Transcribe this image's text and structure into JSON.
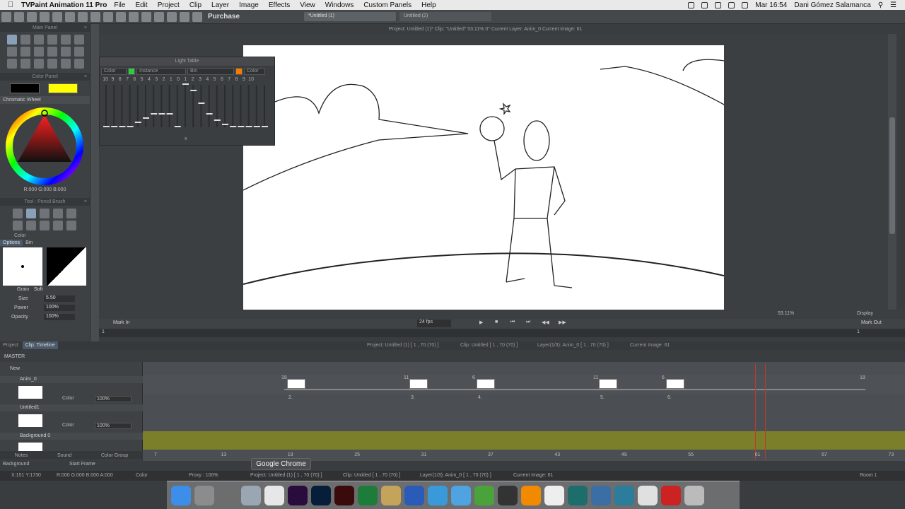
{
  "menubar": {
    "app_name": "TVPaint Animation 11 Pro",
    "items": [
      "File",
      "Edit",
      "Project",
      "Clip",
      "Layer",
      "Image",
      "Effects",
      "View",
      "Windows",
      "Custom Panels",
      "Help"
    ],
    "clock": "Mar 16:54",
    "user": "Dani Gómez Salamanca"
  },
  "toolbar": {
    "purchase": "Purchase",
    "tabs": [
      "*Untitled (1)",
      "Untitled (2)"
    ]
  },
  "panels": {
    "main_panel": "Main Panel",
    "color_panel": "Color Panel",
    "chromatic_wheel": "Chromatic Wheel",
    "rgb_readout": "R:000 G:000 B:000",
    "tool_panel": "Tool : Pencil Brush",
    "color_label": "Color",
    "options_tab": "Options",
    "bin_tab": "Bin",
    "grain_label": "Grain",
    "grain_value": "Soft",
    "size_label": "Size",
    "size_value": "5.50",
    "power_label": "Power",
    "power_value": "100%",
    "opacity_label": "Opacity",
    "opacity_value": "100%"
  },
  "lighttable": {
    "title": "Light Table",
    "color_left": "Color",
    "instance": "Instance",
    "bin": "Bin",
    "color_right": "Color",
    "numbers": [
      "10",
      "9",
      "8",
      "7",
      "6",
      "5",
      "4",
      "3",
      "2",
      "1",
      "0",
      "1",
      "2",
      "3",
      "4",
      "5",
      "6",
      "7",
      "8",
      "9",
      "10"
    ],
    "x_label": "x"
  },
  "viewport": {
    "project_info": "Project: Untitled (1)*  Clip: \"Untitled\"  53.11%  0°  Current Layer: Anim_0  Current Image: 61",
    "zoom": "53.11%",
    "display": "Display",
    "fps": "24 fps",
    "mark_in": "Mark In",
    "mark_out": "Mark Out",
    "frame_start": "1",
    "frame_end": "1"
  },
  "timeline": {
    "tabs": [
      "Project",
      "Clip: Timeline"
    ],
    "info": [
      "Project: Untitled (1) [ 1 , 70  (70) ]",
      "Clip: Untitled [ 1 , 70  (70) ]",
      "Layer(1/3): Anim_0 [ 1 , 70  (70) ]",
      "Current Image: 61"
    ],
    "master": "MASTER",
    "new": "New",
    "ruler": [
      "7",
      "13",
      "19",
      "25",
      "31",
      "37",
      "43",
      "49",
      "55",
      "61",
      "67",
      "73"
    ],
    "layers": [
      {
        "name": "Anim_0",
        "blend": "Color",
        "opacity": "100%"
      },
      {
        "name": "Untitled1",
        "blend": "Color",
        "opacity": "100%"
      },
      {
        "name": "Background 0"
      }
    ],
    "cel_numbers": [
      "2.",
      "3.",
      "4.",
      "5.",
      "6."
    ],
    "cel_marks": [
      "18",
      "11",
      "6",
      "11",
      "6",
      "18"
    ],
    "bottom_tabs": [
      "Notes",
      "Sound",
      "Color Group"
    ],
    "background": "Background",
    "start_frame": "Start Frame"
  },
  "statusbar": {
    "coords": "X:151  Y:1730",
    "rgba": "R:000 G:000 B:000 A:000",
    "color": "Color",
    "proxy": "Proxy : 100%",
    "project": "Project: Untitled (1) [ 1 , 70  (70) ]",
    "clip": "Clip: Untitled [ 1 , 70  (70) ]",
    "layer": "Layer(1/3): Anim_0 [ 1 , 70  (70) ]",
    "current": "Current Image: 61",
    "room": "Room 1"
  },
  "tooltip": "Google Chrome",
  "dock": [
    "Finder",
    "Launchpad",
    "System Preferences",
    "Preview",
    "Google Chrome",
    "Premiere",
    "Photoshop",
    "Animate",
    "TextEdit",
    "Pencil",
    "Word",
    "blurb",
    "Xcode",
    "uTorrent",
    "Box",
    "VLC",
    "iTunes",
    "Maya",
    "Clapper",
    "Butterfly",
    "Stamp",
    "Stack",
    "Trash"
  ],
  "colors": {
    "primary": "#000000",
    "secondary": "#ffff00",
    "lt_green": "#2ecc40",
    "lt_orange": "#f57c00",
    "bg_layer": "#7c7f2a",
    "playhead": "#c0392b"
  }
}
